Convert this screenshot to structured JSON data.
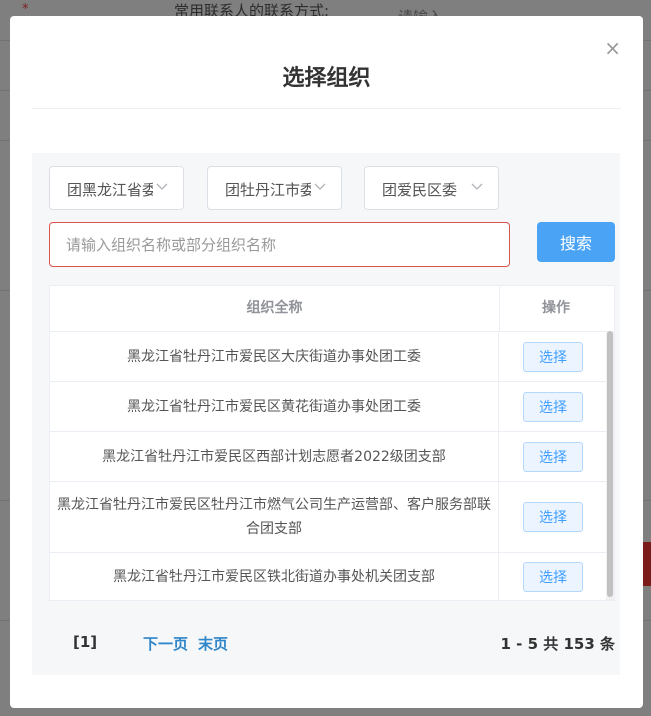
{
  "background": {
    "required_mark": "*",
    "field_label": "常用联系人的联系方式:",
    "field_placeholder": "请输入"
  },
  "modal": {
    "title": "选择组织",
    "close_glyph": "×",
    "filters": [
      {
        "value": "团黑龙江省委"
      },
      {
        "value": "团牡丹江市委"
      },
      {
        "value": "团爱民区委"
      }
    ],
    "search": {
      "placeholder": "请输入组织名称或部分组织名称",
      "value": "",
      "button_label": "搜索"
    },
    "table": {
      "headers": {
        "name": "组织全称",
        "action": "操作"
      },
      "rows": [
        {
          "name": "黑龙江省牡丹江市爱民区大庆街道办事处团工委",
          "action": "选择"
        },
        {
          "name": "黑龙江省牡丹江市爱民区黄花街道办事处团工委",
          "action": "选择"
        },
        {
          "name": "黑龙江省牡丹江市爱民区西部计划志愿者2022级团支部",
          "action": "选择"
        },
        {
          "name": "黑龙江省牡丹江市爱民区牡丹江市燃气公司生产运营部、客户服务部联合团支部",
          "action": "选择"
        },
        {
          "name": "黑龙江省牡丹江市爱民区铁北街道办事处机关团支部",
          "action": "选择"
        }
      ]
    },
    "pagination": {
      "current": "[1]",
      "next": "下一页",
      "last": "末页",
      "summary": "1 - 5  共 153 条"
    }
  },
  "colors": {
    "accent": "#4aa3f5",
    "error_border": "#d9534f",
    "link": "#2f86c9"
  }
}
